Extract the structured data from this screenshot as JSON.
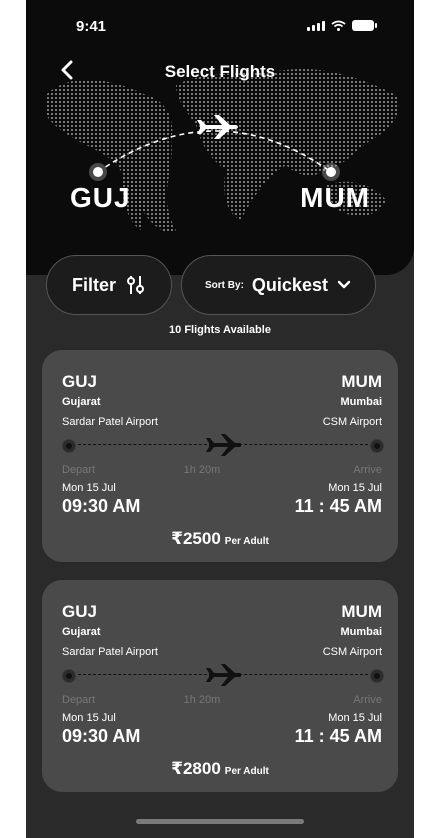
{
  "status_bar": {
    "time": "9:41",
    "icons": [
      "signal-icon",
      "wifi-icon",
      "battery-icon"
    ]
  },
  "header": {
    "title": "Select Flights",
    "back_icon": "chevron-left-icon"
  },
  "route": {
    "from_code": "GUJ",
    "to_code": "MUM"
  },
  "controls": {
    "filter_label": "Filter",
    "filter_icon": "sliders-icon",
    "sort_prefix": "Sort By:",
    "sort_value": "Quickest",
    "sort_icon": "chevron-down-icon"
  },
  "flights_available": "10 Flights Available",
  "flights": [
    {
      "from_code": "GUJ",
      "from_name": "Gujarat",
      "from_airport": "Sardar Patel Airport",
      "to_code": "MUM",
      "to_name": "Mumbai",
      "to_airport": "CSM Airport",
      "depart_label": "Depart",
      "duration": "1h 20m",
      "arrive_label": "Arrive",
      "depart_date": "Mon 15 Jul",
      "arrive_date": "Mon 15 Jul",
      "depart_time": "09:30 AM",
      "arrive_time": "11 : 45 AM",
      "price": "₹2500",
      "per": "Per Adult"
    },
    {
      "from_code": "GUJ",
      "from_name": "Gujarat",
      "from_airport": "Sardar Patel Airport",
      "to_code": "MUM",
      "to_name": "Mumbai",
      "to_airport": "CSM Airport",
      "depart_label": "Depart",
      "duration": "1h 20m",
      "arrive_label": "Arrive",
      "depart_date": "Mon 15 Jul",
      "arrive_date": "Mon 15 Jul",
      "depart_time": "09:30 AM",
      "arrive_time": "11 : 45 AM",
      "price": "₹2800",
      "per": "Per Adult"
    }
  ],
  "colors": {
    "background": "#2a2a2a",
    "hero": "#0b0b0b",
    "card": "#4a4a4a",
    "text": "#ffffff"
  }
}
